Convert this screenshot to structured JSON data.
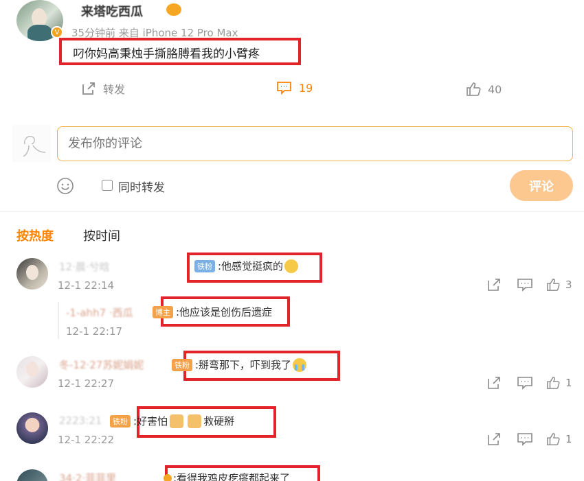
{
  "post": {
    "username": "来塔吃西瓜",
    "meta": "35分钟前 来自 iPhone 12 Pro Max",
    "text": "叼你妈高秉烛手撕胳膊看我的小臂疼"
  },
  "actions": {
    "repost_label": "转发",
    "comment_count": "19",
    "like_count": "40"
  },
  "composer": {
    "placeholder": "发布你的评论",
    "also_repost_label": "同时转发",
    "submit_label": "评论"
  },
  "sort": {
    "hot_label": "按热度",
    "time_label": "按时间"
  },
  "comments": [
    {
      "name": "12·晨·兮晗",
      "badge": "铁粉",
      "text": ":他感觉挺疯的",
      "time": "12-1 22:14",
      "like_count": "3",
      "reply": {
        "name": "-1-ahh7 ·西瓜",
        "badge": "博主",
        "text": ":他应该是创伤后遗症",
        "time": "12-1 22:17"
      }
    },
    {
      "name": "冬-12·27苏妮娟妮",
      "badge": "铁粉",
      "text": ":掰弯那下，吓到我了",
      "time": "12-1 22:27",
      "like_count": "1"
    },
    {
      "name": "2223:21",
      "badge": "铁粉",
      "text_a": ":好害怕",
      "text_b": "救硬掰",
      "time": "12-1 22:22",
      "like_count": "1"
    },
    {
      "name": "34·2·菲菲里",
      "text": ":看得我鸡皮疙瘩都起来了"
    }
  ],
  "colors": {
    "accent": "#ff8200",
    "highlight_box": "#e2232a",
    "submit_bg": "#fdc88f"
  }
}
